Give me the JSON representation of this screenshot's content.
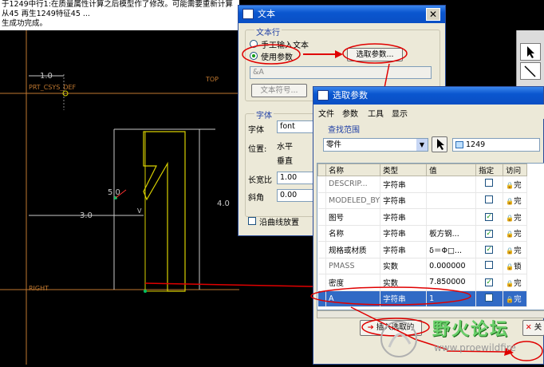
{
  "message_area": {
    "lines": [
      "于1249中行1:在质量属性计算之后模型作了修改。可能需要重新计算",
      "从45 再生1249特征45 ...",
      "生成功完成。"
    ]
  },
  "canvas": {
    "csys_label": "PRT_CSYS_DEF",
    "top_label": "TOP",
    "right_label": "RIGHT",
    "dim_top": "1.0",
    "dim_left": "3.0",
    "dim_mid": "5.0",
    "dim_height": "4.0",
    "v_mark": "V"
  },
  "text_dialog": {
    "title": "文本",
    "close": "✕",
    "text_row_group": "文本行",
    "radio_manual": "手工输入文本",
    "radio_param": "使用参数",
    "select_param_button": "选取参数...",
    "param_value": "&A",
    "text_symbol_button": "文本符号...",
    "font_group": "字体",
    "font_label": "字体",
    "font_value": "font",
    "position_label": "位置:",
    "horizontal_label": "水平",
    "vertical_label": "垂直",
    "aspect_label": "长宽比",
    "aspect_value": "1.00",
    "slant_label": "斜角",
    "slant_value": "0.00",
    "along_curve_label": "沿曲线放置"
  },
  "select_param_dialog": {
    "title": "选取参数",
    "menu": [
      "文件",
      "参数",
      "工具",
      "显示"
    ],
    "scope_label": "查找范围",
    "scope_value": "零件",
    "model_value": "1249",
    "columns": [
      "名称",
      "类型",
      "值",
      "指定",
      "访问"
    ],
    "rows": [
      {
        "name": "DESCRIP...",
        "type": "字符串",
        "value": "",
        "designated": false,
        "access": "完",
        "dim": true
      },
      {
        "name": "MODELED_BY",
        "type": "字符串",
        "value": "",
        "designated": false,
        "access": "完",
        "dim": true
      },
      {
        "name": "图号",
        "type": "字符串",
        "value": "",
        "designated": true,
        "access": "完",
        "dim": false
      },
      {
        "name": "名称",
        "type": "字符串",
        "value": "板方钢...",
        "designated": true,
        "access": "完",
        "dim": false
      },
      {
        "name": "规格或材质",
        "type": "字符串",
        "value": "δ＝Φ□...",
        "designated": true,
        "access": "完",
        "dim": false
      },
      {
        "name": "PMASS",
        "type": "实数",
        "value": "0.000000",
        "designated": false,
        "access": "锁",
        "dim": true
      },
      {
        "name": "密度",
        "type": "实数",
        "value": "7.850000",
        "designated": true,
        "access": "完",
        "dim": false
      },
      {
        "name": "A",
        "type": "字符串",
        "value": "1",
        "designated": false,
        "access": "完",
        "dim": false,
        "selected": true
      }
    ],
    "insert_button": "插入选取的",
    "cancel_partial": "关"
  },
  "watermark": {
    "title": "野火论坛",
    "url": "www.proewildfire"
  },
  "colors": {
    "accent_red": "#e00000",
    "title_blue": "#0a56cf",
    "selection_blue": "#316ac5",
    "sketch_yellow": "#d8d000",
    "dim_gray": "#c8c8c8"
  }
}
